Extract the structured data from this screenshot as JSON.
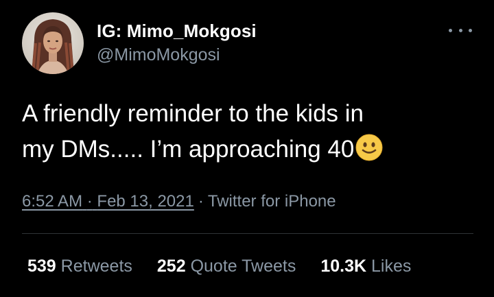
{
  "tweet": {
    "display_name": "IG: Mimo_Mokgosi",
    "handle": "@MimoMokgosi",
    "text_line1": "A friendly reminder to the kids in",
    "text_line2": "my DMs..... I’m approaching 40",
    "emoji": "slightly-smiling-face",
    "time": "6:52 AM",
    "separator": "·",
    "date": "Feb 13, 2021",
    "source": "Twitter for iPhone"
  },
  "stats": {
    "retweets_count": "539",
    "retweets_label": "Retweets",
    "quotes_count": "252",
    "quotes_label": "Quote Tweets",
    "likes_count": "10.3K",
    "likes_label": "Likes"
  },
  "colors": {
    "background": "#000000",
    "primary_text": "#ffffff",
    "secondary_text": "#8b98a5",
    "divider": "#2f3336",
    "emoji_yellow": "#f7c948"
  }
}
